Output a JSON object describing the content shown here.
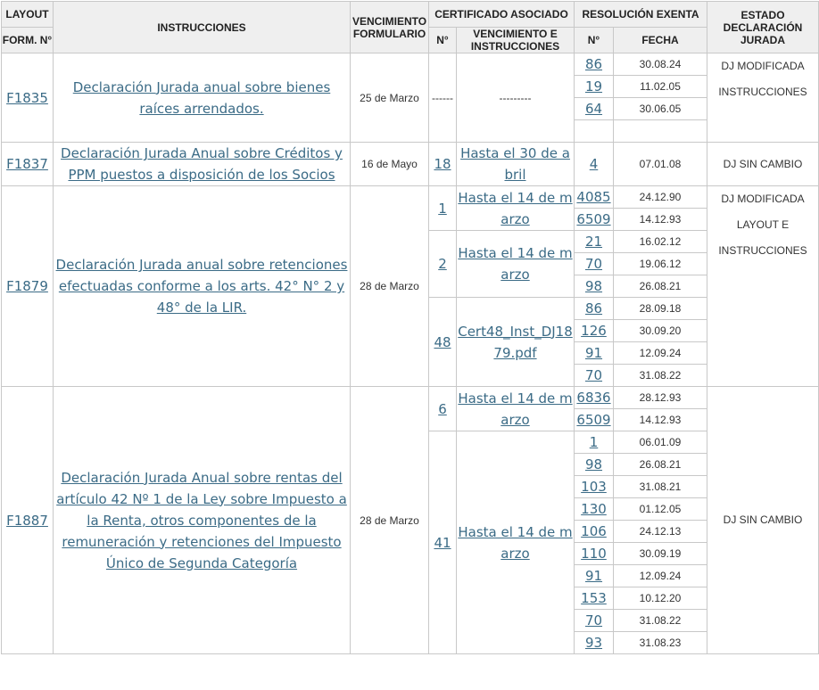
{
  "headers": {
    "layout_top": "LAYOUT",
    "layout_bottom": "FORM. N°",
    "instrucciones": "INSTRUCCIONES",
    "vencimiento": "VENCIMIENTO FORMULARIO",
    "certificado": "CERTIFICADO ASOCIADO",
    "resolucion": "RESOLUCIÓN EXENTA",
    "estado": "ESTADO DECLARACIÓN JURADA",
    "cert_num": "N°",
    "cert_venc": "VENCIMIENTO E INSTRUCCIONES",
    "res_num": "N°",
    "res_fecha": "FECHA"
  },
  "rows": [
    {
      "form": "F1835",
      "instrucciones": "Declaración Jurada anual sobre bienes raíces arrendados.",
      "vencimiento": "25 de Marzo",
      "certificados": [
        {
          "num": "------",
          "venc": "---------",
          "linked": false,
          "resoluciones": [
            {
              "num": "86",
              "fecha": "30.08.24"
            },
            {
              "num": "19",
              "fecha": "11.02.05"
            },
            {
              "num": "64",
              "fecha": "30.06.05"
            },
            {
              "num": "",
              "fecha": ""
            }
          ]
        }
      ],
      "estado": [
        "DJ MODIFICADA",
        "INSTRUCCIONES"
      ]
    },
    {
      "form": "F1837",
      "instrucciones": "Declaración Jurada Anual sobre Créditos y PPM puestos a disposición de los Socios",
      "vencimiento": "16 de Mayo",
      "certificados": [
        {
          "num": "18",
          "venc": "Hasta el 30 de abril",
          "linked": true,
          "resoluciones": [
            {
              "num": "4",
              "fecha": "07.01.08"
            }
          ]
        }
      ],
      "estado": [
        "DJ SIN CAMBIO"
      ]
    },
    {
      "form": "F1879",
      "instrucciones": "Declaración Jurada anual sobre retenciones efectuadas conforme a los arts. 42° N° 2 y 48° de la LIR.",
      "vencimiento": "28 de Marzo",
      "certificados": [
        {
          "num": "1",
          "venc": "Hasta el 14 de marzo",
          "linked": true,
          "resoluciones": [
            {
              "num": "4085",
              "fecha": "24.12.90"
            },
            {
              "num": "6509",
              "fecha": "14.12.93"
            }
          ]
        },
        {
          "num": "2",
          "venc": "Hasta el 14 de marzo",
          "linked": true,
          "resoluciones": [
            {
              "num": "21",
              "fecha": "16.02.12"
            },
            {
              "num": "70",
              "fecha": "19.06.12"
            },
            {
              "num": "98",
              "fecha": "26.08.21"
            }
          ]
        },
        {
          "num": "48",
          "venc": "Cert48_Inst_DJ1879.pdf",
          "linked": true,
          "resoluciones": [
            {
              "num": "86",
              "fecha": "28.09.18"
            },
            {
              "num": "126",
              "fecha": "30.09.20"
            },
            {
              "num": "91",
              "fecha": "12.09.24"
            },
            {
              "num": "70",
              "fecha": "31.08.22"
            }
          ]
        }
      ],
      "estado": [
        "DJ MODIFICADA",
        "LAYOUT E",
        "INSTRUCCIONES"
      ]
    },
    {
      "form": "F1887",
      "instrucciones": "Declaración Jurada Anual sobre rentas del artículo 42 Nº 1 de la Ley sobre Impuesto a la Renta, otros componentes de la remuneración y retenciones del Impuesto Único de Segunda Categoría",
      "vencimiento": "28 de Marzo",
      "certificados": [
        {
          "num": "6",
          "venc": "Hasta el 14 de marzo",
          "linked": true,
          "resoluciones": [
            {
              "num": "6836",
              "fecha": "28.12.93"
            },
            {
              "num": "6509",
              "fecha": "14.12.93"
            }
          ]
        },
        {
          "num": "41",
          "venc": "Hasta el 14 de marzo",
          "linked": true,
          "resoluciones": [
            {
              "num": "1",
              "fecha": "06.01.09"
            },
            {
              "num": "98",
              "fecha": "26.08.21"
            },
            {
              "num": "103",
              "fecha": "31.08.21"
            },
            {
              "num": "130",
              "fecha": "01.12.05"
            },
            {
              "num": "106",
              "fecha": "24.12.13"
            },
            {
              "num": "110",
              "fecha": "30.09.19"
            },
            {
              "num": "91",
              "fecha": "12.09.24"
            },
            {
              "num": "153",
              "fecha": "10.12.20"
            },
            {
              "num": "70",
              "fecha": "31.08.22"
            },
            {
              "num": "93",
              "fecha": "31.08.23"
            }
          ]
        }
      ],
      "estado": [
        "DJ SIN CAMBIO"
      ]
    }
  ]
}
